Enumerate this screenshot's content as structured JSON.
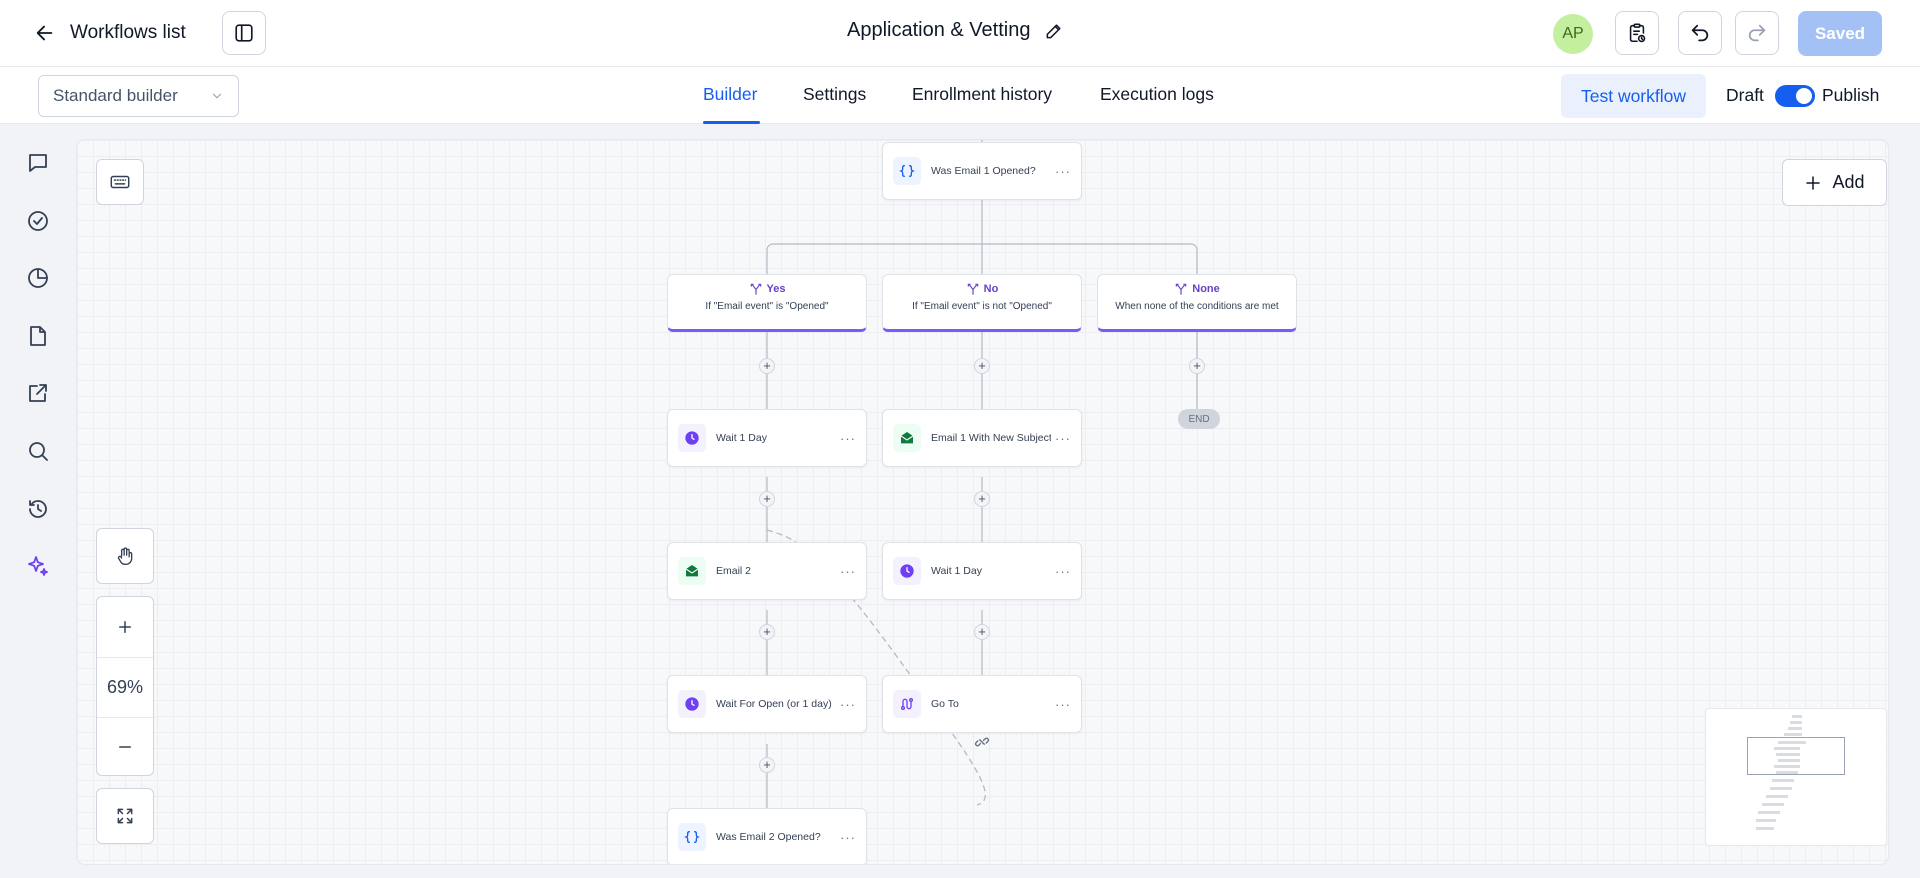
{
  "header": {
    "back_label": "Workflows list",
    "title": "Application & Vetting",
    "avatar_initials": "AP",
    "saved_label": "Saved"
  },
  "subbar": {
    "builder_select": "Standard builder",
    "tabs": [
      {
        "label": "Builder",
        "active": true
      },
      {
        "label": "Settings",
        "active": false
      },
      {
        "label": "Enrollment history",
        "active": false
      },
      {
        "label": "Execution logs",
        "active": false
      }
    ],
    "test_workflow_label": "Test workflow",
    "draft_label": "Draft",
    "publish_label": "Publish",
    "publish_toggle_on": true
  },
  "rail": [
    "chat-icon",
    "check-circle-icon",
    "pie-chart-icon",
    "file-icon",
    "external-link-icon",
    "search-icon",
    "history-icon",
    "sparkles-icon"
  ],
  "canvas": {
    "add_label": "Add",
    "zoom_level": "69%",
    "nodes": {
      "condition1": "Was Email 1 Opened?",
      "yes_wait": "Wait 1 Day",
      "yes_email2": "Email 2",
      "yes_wait_open": "Wait For Open (or 1 day)",
      "condition2": "Was Email 2 Opened?",
      "no_email": "Email 1 With New Subject",
      "no_wait": "Wait 1 Day",
      "no_goto": "Go To"
    },
    "branches": [
      {
        "title": "Yes",
        "desc": "If \"Email event\" is \"Opened\""
      },
      {
        "title": "No",
        "desc": "If \"Email event\" is not \"Opened\""
      },
      {
        "title": "None",
        "desc": "When none of the conditions are met"
      }
    ],
    "end_label": "END",
    "more_glyph": "···",
    "plus_glyph": "+"
  },
  "colors": {
    "accent": "#155eef",
    "branch_accent": "#7a5af8",
    "wait_icon": "#6e3ff3",
    "email_icon": "#0f7a3c",
    "condition_icon": "#155eef"
  }
}
